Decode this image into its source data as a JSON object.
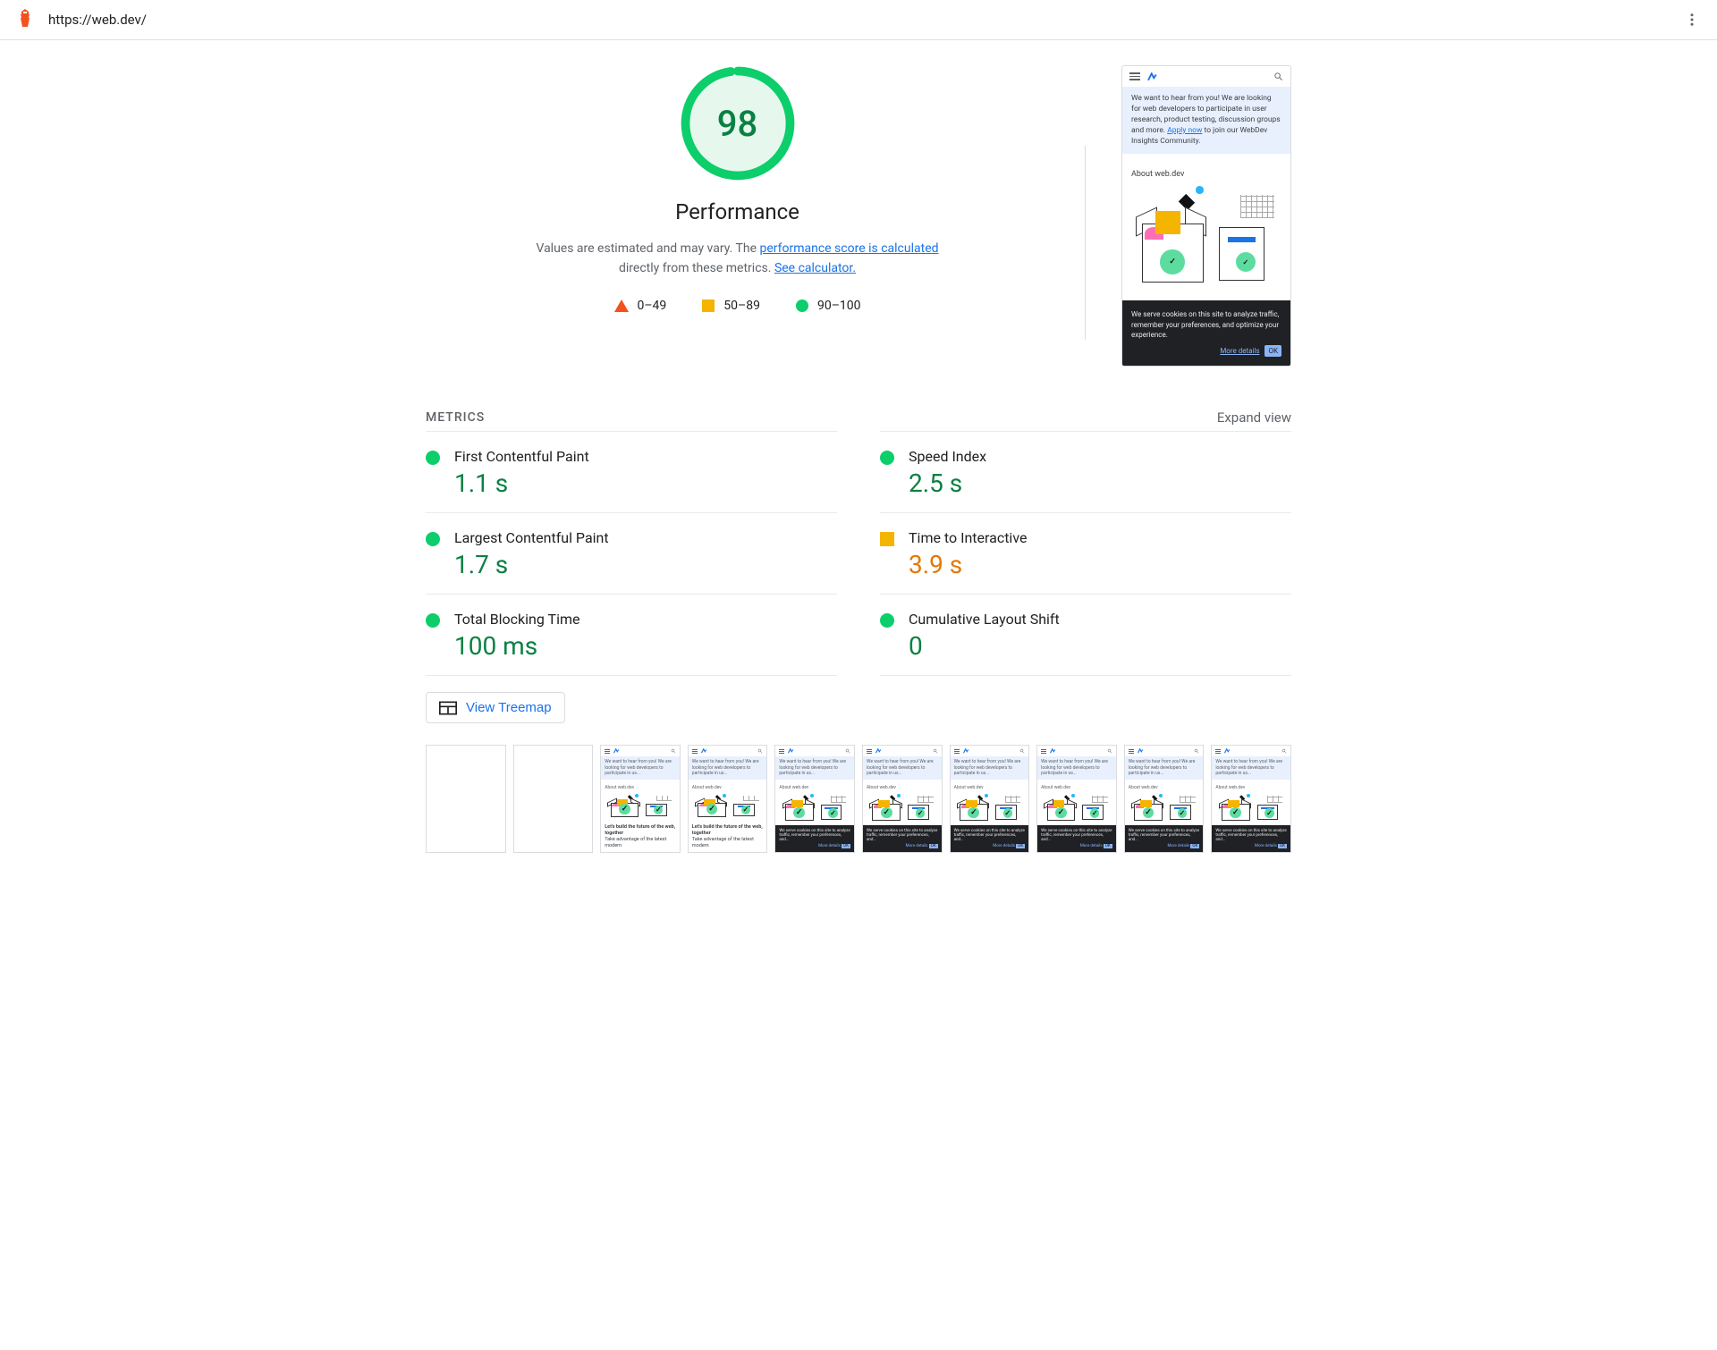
{
  "header": {
    "url": "https://web.dev/"
  },
  "gauge": {
    "score": "98",
    "title": "Performance",
    "desc_prefix": "Values are estimated and may vary. The ",
    "desc_link1": "performance score is calculated",
    "desc_mid": " directly from these metrics. ",
    "desc_link2": "See calculator.",
    "color_pass": "#0cce6b",
    "color_pass_bg": "#e6f8ee"
  },
  "legend": {
    "fail": "0–49",
    "avg": "50–89",
    "pass": "90–100"
  },
  "preview": {
    "banner_prefix": "We want to hear from you! We are looking for web developers to participate in user research, product testing, discussion groups and more. ",
    "banner_link": "Apply now",
    "banner_suffix": " to join our WebDev Insights Community.",
    "about": "About web.dev",
    "cookie": "We serve cookies on this site to analyze traffic, remember your preferences, and optimize your experience.",
    "more": "More details",
    "ok": "OK"
  },
  "metrics": {
    "section_label": "METRICS",
    "expand": "Expand view",
    "items": [
      {
        "name": "First Contentful Paint",
        "value": "1.1 s",
        "status": "green"
      },
      {
        "name": "Speed Index",
        "value": "2.5 s",
        "status": "green"
      },
      {
        "name": "Largest Contentful Paint",
        "value": "1.7 s",
        "status": "green"
      },
      {
        "name": "Time to Interactive",
        "value": "3.9 s",
        "status": "orange"
      },
      {
        "name": "Total Blocking Time",
        "value": "100 ms",
        "status": "green"
      },
      {
        "name": "Cumulative Layout Shift",
        "value": "0",
        "status": "green"
      }
    ]
  },
  "treemap": {
    "label": "View Treemap"
  },
  "filmstrip": {
    "caption_build": "Let's build the future of the web, together",
    "caption_sub": "Take advantage of the latest modern",
    "frames": [
      {
        "state": "blank"
      },
      {
        "state": "blank"
      },
      {
        "state": "partial"
      },
      {
        "state": "partial"
      },
      {
        "state": "cookie"
      },
      {
        "state": "cookie"
      },
      {
        "state": "cookie"
      },
      {
        "state": "cookie"
      },
      {
        "state": "cookie"
      },
      {
        "state": "cookie"
      }
    ]
  }
}
